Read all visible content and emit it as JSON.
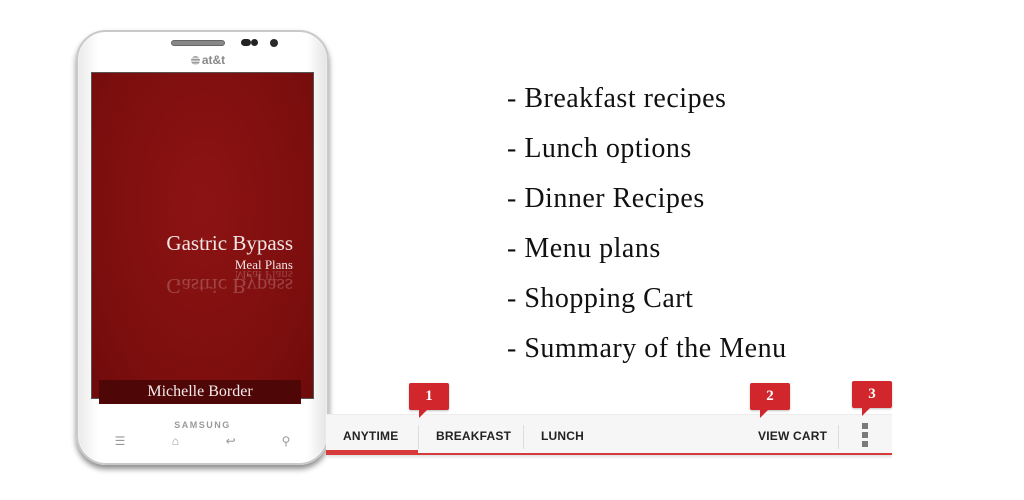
{
  "phone": {
    "carrier": "at&t",
    "brand": "SAMSUNG",
    "app_title": "Gastric Bypass",
    "app_subtitle": "Meal Plans",
    "author": "Michelle Border",
    "nav_keys": {
      "menu": "☰",
      "home": "⌂",
      "back": "↩",
      "search": "⚲"
    },
    "colors": {
      "screen": "#7c0e0e",
      "author_bar": "#4e0606"
    }
  },
  "features": [
    "- Breakfast recipes",
    "- Lunch options",
    "- Dinner Recipes",
    "- Menu plans",
    "- Shopping Cart",
    "- Summary of the Menu"
  ],
  "tabbar": {
    "tabs": [
      {
        "label": "ANYTIME",
        "active": true
      },
      {
        "label": "BREAKFAST",
        "active": false
      },
      {
        "label": "LUNCH",
        "active": false
      }
    ],
    "view_cart": "VIEW CART",
    "overflow_icon": "overflow-menu-icon",
    "accent": "#d63a3a"
  },
  "callouts": [
    "1",
    "2",
    "3"
  ],
  "callout_color": "#d1262c"
}
